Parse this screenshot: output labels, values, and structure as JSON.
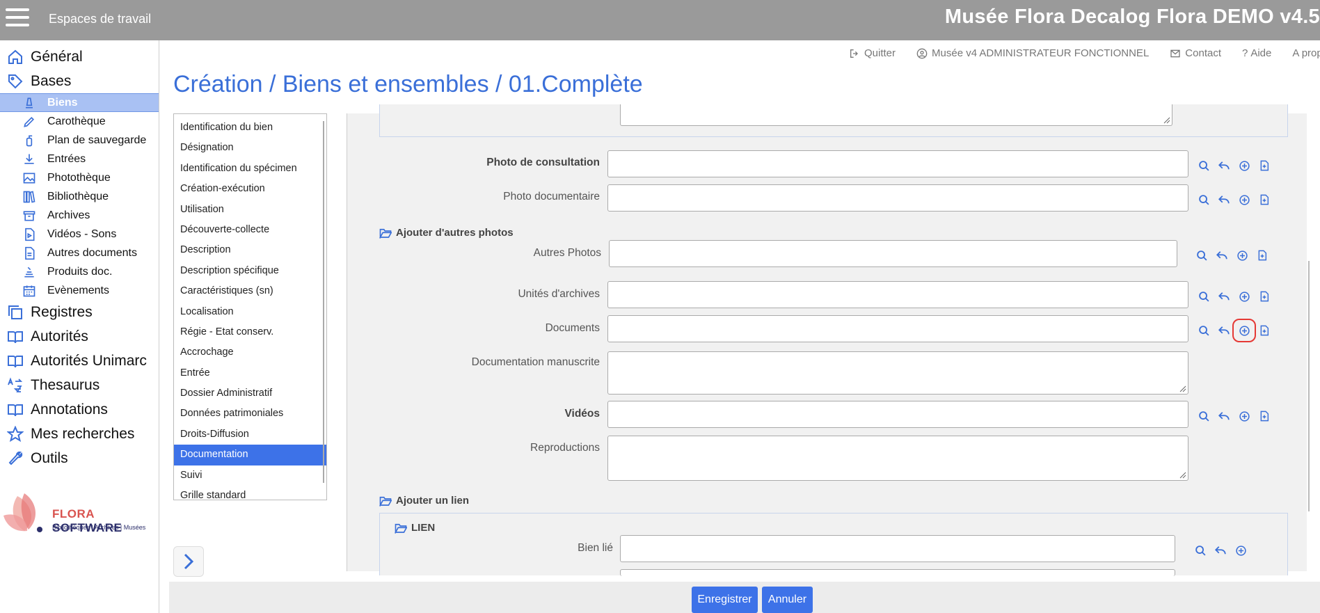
{
  "topbar": {
    "workspaces": "Espaces de travail",
    "app_title": "Musée Flora Decalog Flora DEMO v4.5"
  },
  "nav": {
    "general": "Général",
    "bases": "Bases",
    "sub": [
      "Biens",
      "Carothèque",
      "Plan de sauvegarde",
      "Entrées",
      "Photothèque",
      "Bibliothèque",
      "Archives",
      "Vidéos - Sons",
      "Autres documents",
      "Produits doc.",
      "Evènements"
    ],
    "main_after": [
      "Registres",
      "Autorités",
      "Autorités Unimarc",
      "Thesaurus",
      "Annotations",
      "Mes recherches",
      "Outils"
    ]
  },
  "logo": {
    "brand_a": "FLORA ",
    "brand_b": "SOFTWARE",
    "tagline": "Bibliothèques | Archives | Musées"
  },
  "header_links": [
    "Quitter",
    "Musée v4 ADMINISTRATEUR FONCTIONNEL",
    "Contact",
    "Aide",
    "A propos"
  ],
  "page_title": "Création / Biens et ensembles / 01.Complète",
  "sections": [
    "Identification du bien",
    "Désignation",
    "Identification du spécimen",
    "Création-exécution",
    "Utilisation",
    "Découverte-collecte",
    "Description",
    "Description spécifique",
    "Caractéristiques (sn)",
    "Localisation",
    "Régie - Etat conserv.",
    "Accrochage",
    "Entrée",
    "Dossier Administratif",
    "Données patrimoniales",
    "Droits-Diffusion",
    "Documentation",
    "Suivi",
    "Grille standard"
  ],
  "active_section": "Documentation",
  "form": {
    "photo_consultation": "Photo de consultation",
    "photo_documentaire": "Photo documentaire",
    "group_autres_photos": "Ajouter d'autres photos",
    "autres_photos": "Autres Photos",
    "unites_archives": "Unités d'archives",
    "documents": "Documents",
    "documentation_manuscrite": "Documentation manuscrite",
    "videos": "Vidéos",
    "reproductions": "Reproductions",
    "group_lien": "Ajouter un lien",
    "lien": "LIEN",
    "bien_lie": "Bien lié"
  },
  "buttons": {
    "save": "Enregistrer",
    "cancel": "Annuler"
  },
  "colors": {
    "accent": "#3a6fd8",
    "topbar": "#9a9a9a",
    "highlight": "#e53935"
  }
}
